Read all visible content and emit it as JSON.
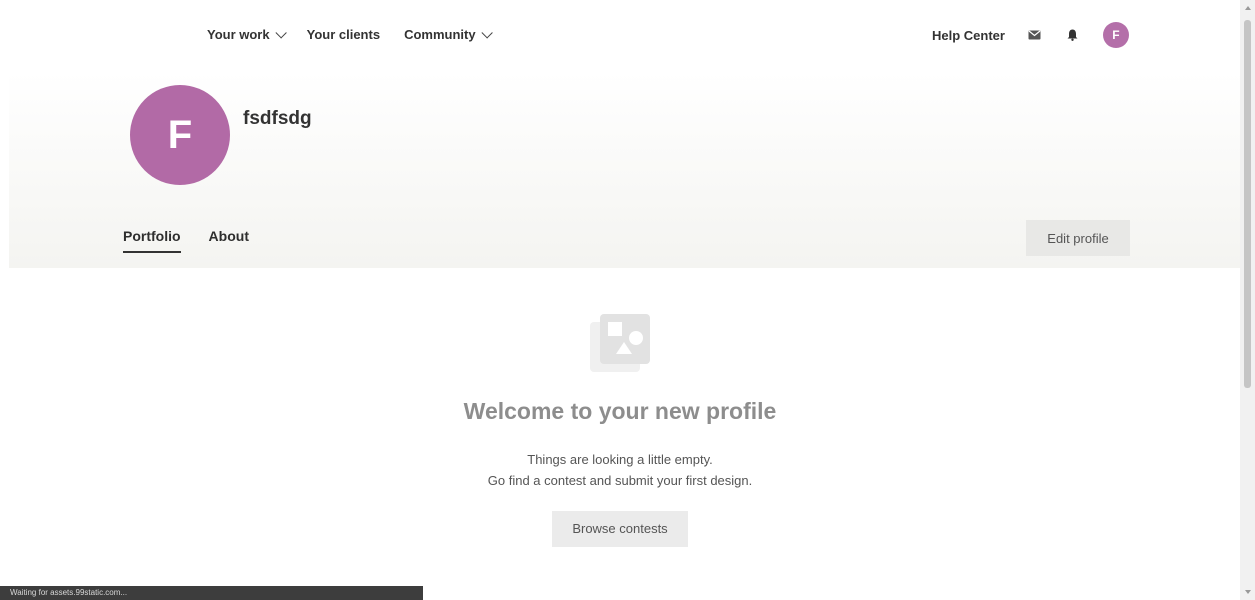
{
  "nav": {
    "your_work": "Your work",
    "your_clients": "Your clients",
    "community": "Community",
    "help_center": "Help Center",
    "avatar_initial": "F",
    "icons": [
      "mail-icon",
      "bell-icon"
    ]
  },
  "profile": {
    "initial": "F",
    "username": "fsdfsdg",
    "avatar_color": "#b26aa6",
    "tabs": [
      {
        "label": "Portfolio",
        "active": true
      },
      {
        "label": "About",
        "active": false
      }
    ],
    "edit_button": "Edit profile"
  },
  "empty_state": {
    "icon": "image-gallery-icon",
    "title": "Welcome to your new profile",
    "line1": "Things are looking a little empty.",
    "line2": "Go find a contest and submit your first design.",
    "button": "Browse contests"
  },
  "status_bar": {
    "text": "Waiting for assets.99static.com..."
  }
}
